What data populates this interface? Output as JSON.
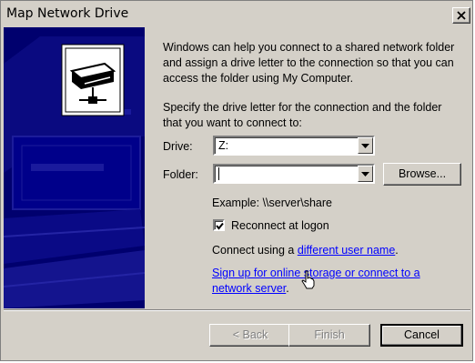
{
  "window": {
    "title": "Map Network Drive"
  },
  "intro": "Windows can help you connect to a shared network folder and assign a drive letter to the connection so that you can access the folder using My Computer.",
  "instructions": "Specify the drive letter for the connection and the folder that you want to connect to:",
  "drive": {
    "label": "Drive:",
    "value": "Z:"
  },
  "folder": {
    "label": "Folder:",
    "value": ""
  },
  "browse_label": "Browse...",
  "example": "Example: \\\\server\\share",
  "reconnect": {
    "label": "Reconnect at logon",
    "checked": true
  },
  "connect_using": {
    "prefix": "Connect using a ",
    "link": "different user name",
    "suffix": "."
  },
  "signup": {
    "link": "Sign up for online storage or connect to a network server",
    "suffix": "."
  },
  "buttons": {
    "back": "< Back",
    "finish": "Finish",
    "cancel": "Cancel"
  },
  "colors": {
    "dialog_bg": "#d4d0c8",
    "side_panel": "#00006e",
    "link": "#0000ff"
  },
  "icons": [
    "close-icon",
    "network-drive-icon",
    "dropdown-arrow-icon",
    "checkmark-icon",
    "hand-cursor-icon"
  ]
}
